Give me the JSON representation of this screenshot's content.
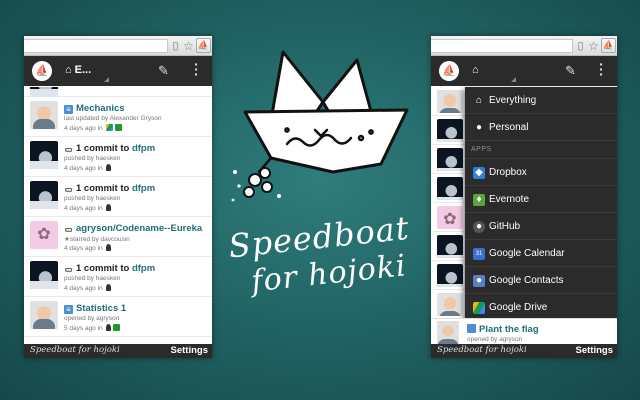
{
  "promo": {
    "tagline_line1": "Speedboat",
    "tagline_line2": "for hojoki"
  },
  "left_panel": {
    "header": {
      "home_label": "E..."
    },
    "feed": [
      {
        "avatar": "face",
        "title": "Mechanics",
        "title_icon": "doc",
        "sub": "last updated by Alexander Gryson",
        "meta": "4 days ago in",
        "services": [
          "drive",
          "green"
        ]
      },
      {
        "avatar": "moon",
        "title_prefix": "1 commit to",
        "title_link": "dfpm",
        "title_icon": "repo",
        "sub": "pushed by haesken",
        "meta": "4 days ago in",
        "services": [
          "person"
        ]
      },
      {
        "avatar": "moon",
        "title_prefix": "1 commit to",
        "title_link": "dfpm",
        "title_icon": "repo",
        "sub": "pushed by haesken",
        "meta": "4 days ago in",
        "services": [
          "person"
        ]
      },
      {
        "avatar": "pink",
        "title_link": "agryson/Codename--Eureka",
        "title_icon": "repo",
        "sub": "★starred by davcousin",
        "meta": "4 days ago in",
        "services": [
          "person"
        ]
      },
      {
        "avatar": "moon",
        "title_prefix": "1 commit to",
        "title_link": "dfpm",
        "title_icon": "repo",
        "sub": "pushed by haesken",
        "meta": "4 days ago in",
        "services": [
          "person"
        ]
      },
      {
        "avatar": "face",
        "title_link": "Statistics 1",
        "title_icon": "sheet",
        "sub": "opened by agryson",
        "meta": "5 days ago in",
        "services": [
          "person",
          "green"
        ]
      }
    ],
    "footer": {
      "brand": "Speedboat for hojoki",
      "settings_label": "Settings"
    }
  },
  "right_panel": {
    "header": {
      "home_label": ""
    },
    "menu": {
      "items_top": [
        {
          "label": "Everything",
          "icon": "home-icon"
        },
        {
          "label": "Personal",
          "icon": "person-icon"
        }
      ],
      "section_label": "APPS",
      "apps": [
        {
          "label": "Dropbox",
          "icon": "dropbox-icon"
        },
        {
          "label": "Evernote",
          "icon": "evernote-icon"
        },
        {
          "label": "GitHub",
          "icon": "github-icon"
        },
        {
          "label": "Google Calendar",
          "icon": "google-calendar-icon",
          "badge": "31"
        },
        {
          "label": "Google Contacts",
          "icon": "google-contacts-icon"
        },
        {
          "label": "Google Drive",
          "icon": "google-drive-icon"
        }
      ]
    },
    "bottom_item": {
      "title": "Plant the flag",
      "sub": "opened by agryson"
    },
    "footer": {
      "brand": "Speedboat for hojoki",
      "settings_label": "Settings"
    }
  },
  "colors": {
    "background": "#1f5f60",
    "appbar": "#2b2b2b",
    "link": "#1e6e7b"
  }
}
